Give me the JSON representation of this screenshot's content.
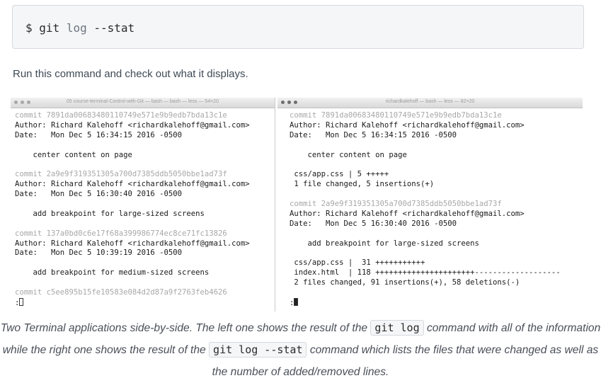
{
  "code_block": {
    "prompt": "$",
    "git": "git",
    "log": "log",
    "flag": "--stat"
  },
  "intro_text": "Run this command and check out what it displays.",
  "left_terminal": {
    "window_title": "05 course-terminal-Control-with-Git — bash — bash — less — 54×20",
    "lines": [
      {
        "type": "commit",
        "text": "commit 7891da00683480110749e571e9b9edb7bda13c1e"
      },
      {
        "type": "text",
        "text": "Author: Richard Kalehoff <richardkalehoff@gmail.com>"
      },
      {
        "type": "text",
        "text": "Date:   Mon Dec 5 16:34:15 2016 -0500"
      },
      {
        "type": "text",
        "text": ""
      },
      {
        "type": "text",
        "text": "    center content on page"
      },
      {
        "type": "text",
        "text": ""
      },
      {
        "type": "commit",
        "text": "commit 2a9e9f319351305a700d7385ddb5050bbe1ad73f"
      },
      {
        "type": "text",
        "text": "Author: Richard Kalehoff <richardkalehoff@gmail.com>"
      },
      {
        "type": "text",
        "text": "Date:   Mon Dec 5 16:30:40 2016 -0500"
      },
      {
        "type": "text",
        "text": ""
      },
      {
        "type": "text",
        "text": "    add breakpoint for large-sized screens"
      },
      {
        "type": "text",
        "text": ""
      },
      {
        "type": "commit",
        "text": "commit 137a0bd0c6e17f68a399986774ec8ce71fc13826"
      },
      {
        "type": "text",
        "text": "Author: Richard Kalehoff <richardkalehoff@gmail.com>"
      },
      {
        "type": "text",
        "text": "Date:   Mon Dec 5 10:39:19 2016 -0500"
      },
      {
        "type": "text",
        "text": ""
      },
      {
        "type": "text",
        "text": "    add breakpoint for medium-sized screens"
      },
      {
        "type": "text",
        "text": ""
      },
      {
        "type": "commit",
        "text": "commit c5ee895b15fe10583e084d2d87a9f2763feb4626"
      }
    ],
    "prompt": ":"
  },
  "right_terminal": {
    "window_title": "richardkalehoff — bash — less — 82×20",
    "lines": [
      {
        "type": "commit",
        "text": "commit 7891da00683480110749e571e9b9edb7bda13c1e"
      },
      {
        "type": "text",
        "text": "Author: Richard Kalehoff <richardkalehoff@gmail.com>"
      },
      {
        "type": "text",
        "text": "Date:   Mon Dec 5 16:34:15 2016 -0500"
      },
      {
        "type": "text",
        "text": ""
      },
      {
        "type": "text",
        "text": "    center content on page"
      },
      {
        "type": "text",
        "text": ""
      },
      {
        "type": "text",
        "text": " css/app.css | 5 +++++"
      },
      {
        "type": "text",
        "text": " 1 file changed, 5 insertions(+)"
      },
      {
        "type": "text",
        "text": ""
      },
      {
        "type": "commit",
        "text": "commit 2a9e9f319351305a700d7385ddb5050bbe1ad73f"
      },
      {
        "type": "text",
        "text": "Author: Richard Kalehoff <richardkalehoff@gmail.com>"
      },
      {
        "type": "text",
        "text": "Date:   Mon Dec 5 16:30:40 2016 -0500"
      },
      {
        "type": "text",
        "text": ""
      },
      {
        "type": "text",
        "text": "    add breakpoint for large-sized screens"
      },
      {
        "type": "text",
        "text": ""
      },
      {
        "type": "text",
        "text": " css/app.css |  31 +++++++++++"
      },
      {
        "type": "text",
        "text": " index.html  | 118 ++++++++++++++++++++++-------------------"
      },
      {
        "type": "text",
        "text": " 2 files changed, 91 insertions(+), 58 deletions(-)"
      },
      {
        "type": "text",
        "text": ""
      }
    ],
    "prompt": ":"
  },
  "caption": {
    "part1": "Two Terminal applications side-by-side. The left one shows the result of the",
    "code1": "git log",
    "part2": "command with all of the information while the right one shows the result of the",
    "code2": "git log --stat",
    "part3": "command which lists the files that were changed as well as the number of added/removed lines."
  }
}
